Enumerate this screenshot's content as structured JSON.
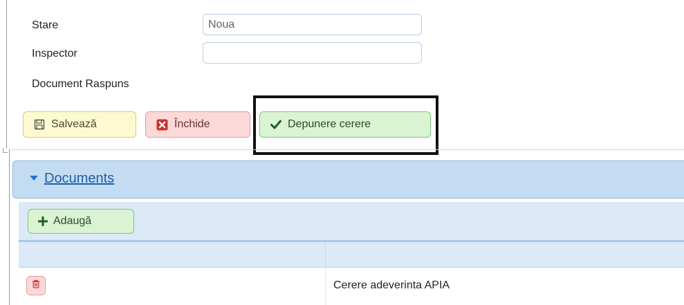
{
  "form": {
    "fields": [
      {
        "label": "Stare",
        "value": "Noua"
      },
      {
        "label": "Inspector",
        "value": ""
      },
      {
        "label": "Document Raspuns"
      }
    ]
  },
  "actions": {
    "save_label": "Salvează",
    "close_label": "Închide",
    "submit_label": "Depunere cerere"
  },
  "colors": {
    "save_bg": "#fdfad2",
    "close_bg": "#fbd9d9",
    "submit_bg": "#daf3d2",
    "panel_header_bg": "#c4dcf2",
    "link": "#1f5fa8"
  },
  "icons": {
    "save": "floppy-disk-icon",
    "close": "close-square-icon",
    "submit": "check-icon",
    "expand": "caret-down-icon",
    "add": "plus-icon",
    "delete": "trash-icon"
  },
  "documents_panel": {
    "title": "Documents",
    "add_label": "Adaugă",
    "columns": [
      "",
      ""
    ],
    "rows": [
      {
        "name": "Cerere adeverinta APIA"
      }
    ]
  }
}
